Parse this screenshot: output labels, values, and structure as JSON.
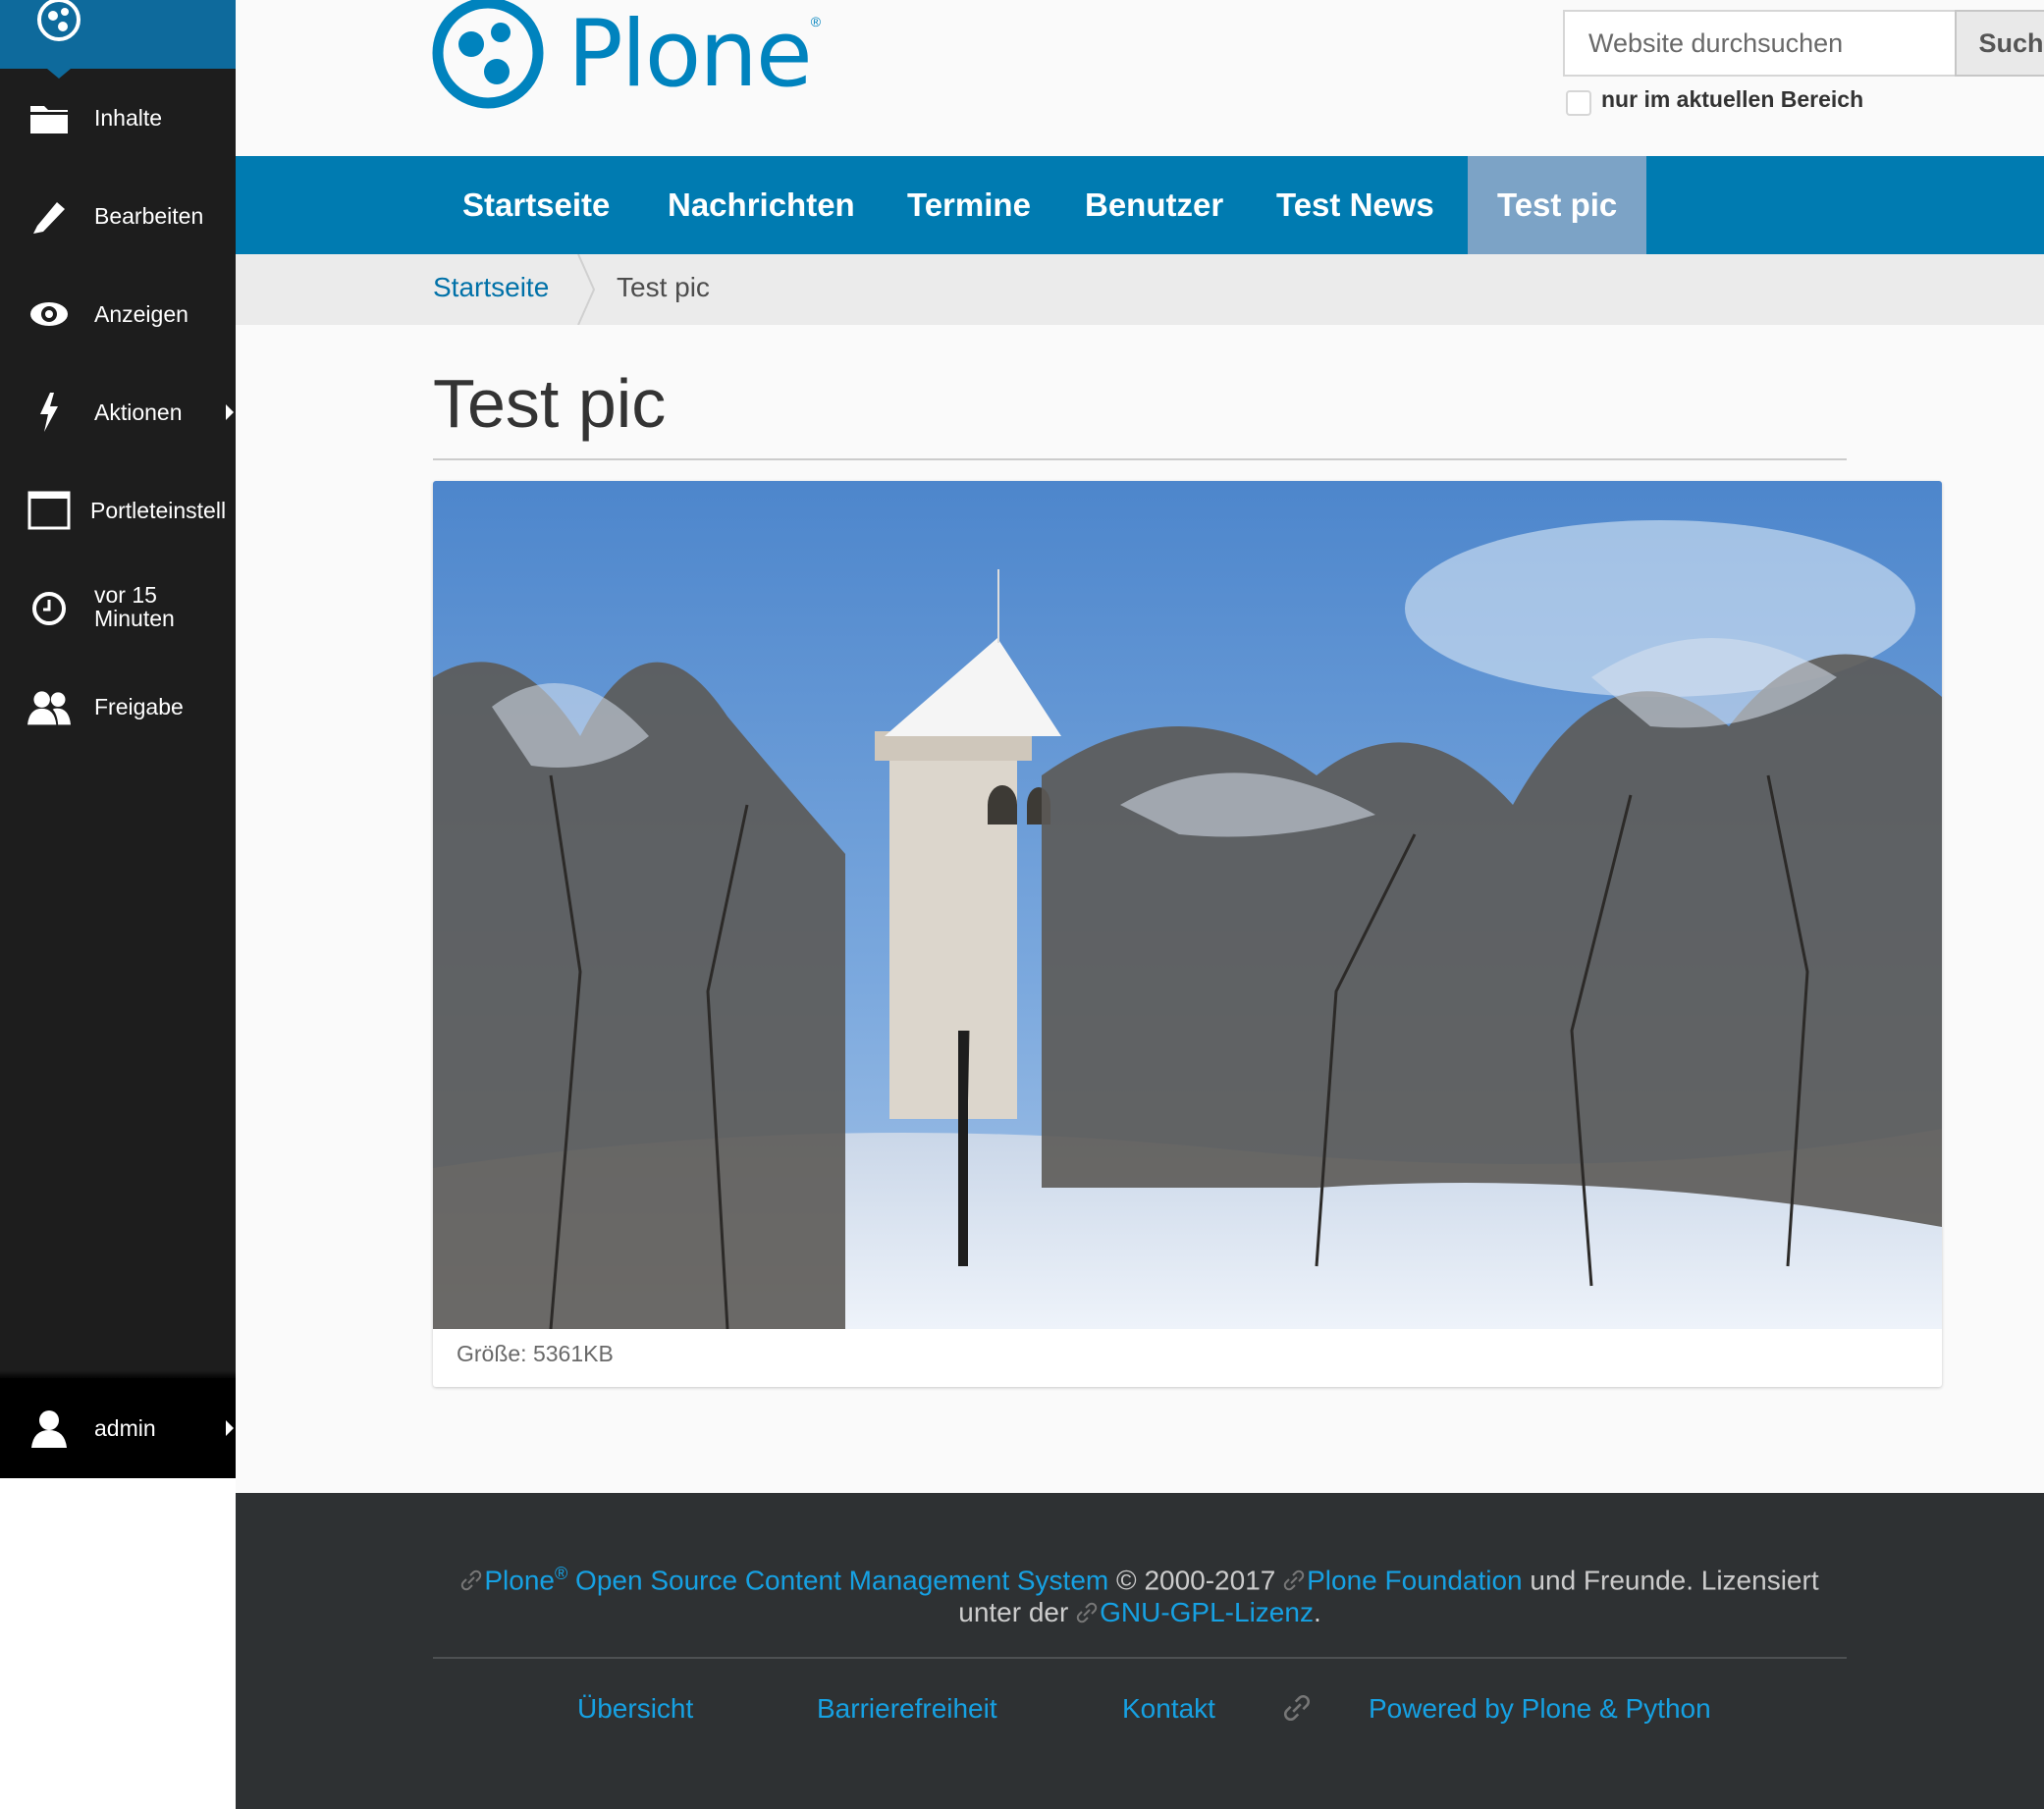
{
  "toolbar": {
    "items": [
      {
        "label": "Inhalte",
        "icon": "folder-icon"
      },
      {
        "label": "Bearbeiten",
        "icon": "pencil-icon"
      },
      {
        "label": "Anzeigen",
        "icon": "eye-icon"
      },
      {
        "label": "Aktionen",
        "icon": "bolt-icon"
      },
      {
        "label": "Portleteinstell",
        "icon": "window-icon"
      },
      {
        "label_line1": "vor 15",
        "label_line2": "Minuten",
        "icon": "clock-icon"
      },
      {
        "label": "Freigabe",
        "icon": "users-icon"
      }
    ],
    "user": {
      "label": "admin",
      "icon": "user-icon"
    }
  },
  "header": {
    "logo_text": "Plone",
    "logo_reg": "®",
    "search_placeholder": "Website durchsuchen",
    "search_button": "Suche",
    "scope_label": "nur im aktuellen Bereich"
  },
  "nav": {
    "items": [
      "Startseite",
      "Nachrichten",
      "Termine",
      "Benutzer",
      "Test News",
      "Test pic"
    ],
    "active": "Test pic"
  },
  "breadcrumbs": {
    "home": "Startseite",
    "current": "Test pic"
  },
  "main": {
    "title": "Test pic",
    "image_size": "Größe: 5361KB"
  },
  "footer": {
    "plone": "Plone",
    "reg": "®",
    "cms": "Open Source Content Management System",
    "copyright": "©",
    "years": "2000-2017",
    "foundation": "Plone Foundation",
    "friends": "und Freunde. Lizensiert",
    "under": "unter der",
    "license": "GNU-GPL-Lizenz",
    "period": ".",
    "links": [
      "Übersicht",
      "Barrierefreiheit",
      "Kontakt",
      "Powered by Plone & Python"
    ]
  },
  "colors": {
    "brand": "#0083be",
    "nav_bg": "#007bb1",
    "nav_active": "#7ca3c6",
    "toolbar_bg": "#1d1d1d",
    "footer_bg": "#2e3133",
    "footer_link": "#16a1e3"
  }
}
